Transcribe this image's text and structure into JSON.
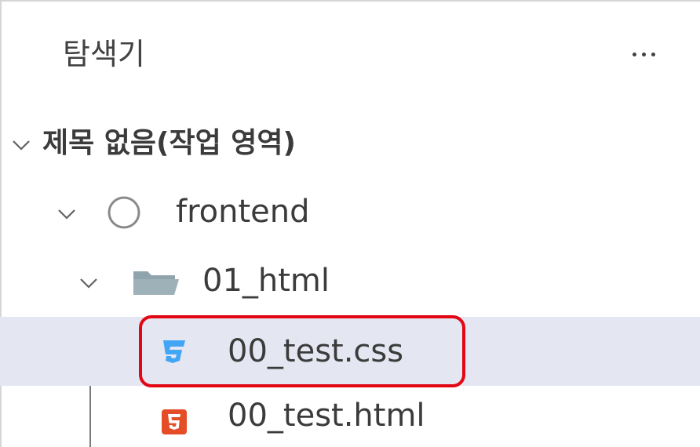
{
  "explorer": {
    "title": "탐색기",
    "more_label": "..."
  },
  "tree": {
    "workspace": {
      "label": "제목 없음(작업 영역)",
      "expanded": true
    },
    "root_folder": {
      "label": "frontend",
      "expanded": true,
      "icon": "circle-outline-icon"
    },
    "sub_folder": {
      "label": "01_html",
      "expanded": true,
      "icon": "folder-open-icon"
    },
    "files": [
      {
        "label": "00_test.css",
        "icon": "css3-icon",
        "selected": true
      },
      {
        "label": "00_test.html",
        "icon": "html5-icon",
        "selected": false
      }
    ]
  },
  "colors": {
    "selection": "#e4e6f1",
    "highlight_outline": "#e30613",
    "css_icon": "#42a5f5",
    "html_icon": "#e44d26",
    "folder_icon": "#90a4ae"
  }
}
